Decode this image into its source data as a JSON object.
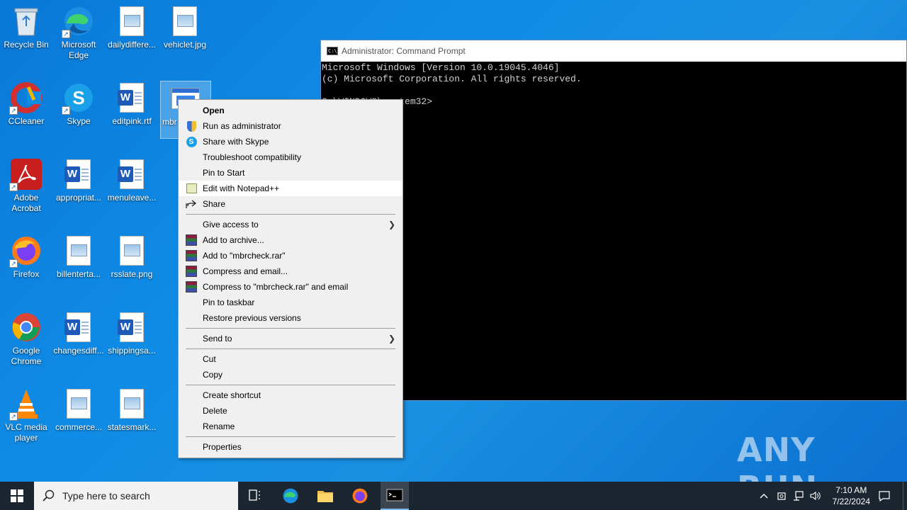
{
  "desktop": {
    "icons": [
      {
        "label": "Recycle Bin",
        "icon": "recycle-bin-icon"
      },
      {
        "label": "Microsoft Edge",
        "icon": "edge-icon"
      },
      {
        "label": "dailydiffere...",
        "icon": "image-file-icon"
      },
      {
        "label": "vehiclet.jpg",
        "icon": "image-file-icon"
      },
      {
        "label": "CCleaner",
        "icon": "ccleaner-icon"
      },
      {
        "label": "Skype",
        "icon": "skype-icon"
      },
      {
        "label": "editpink.rtf",
        "icon": "word-doc-icon"
      },
      {
        "label": "mbr",
        "icon": "exe-file-icon"
      },
      {
        "label": "Adobe Acrobat",
        "icon": "acrobat-icon"
      },
      {
        "label": "appropriat...",
        "icon": "word-doc-icon"
      },
      {
        "label": "menuleave...",
        "icon": "word-doc-icon"
      },
      {
        "label": "Firefox",
        "icon": "firefox-icon"
      },
      {
        "label": "billenterta...",
        "icon": "image-file-icon"
      },
      {
        "label": "rsslate.png",
        "icon": "image-file-icon"
      },
      {
        "label": "Google Chrome",
        "icon": "chrome-icon"
      },
      {
        "label": "changesdiff...",
        "icon": "word-doc-icon"
      },
      {
        "label": "shippingsa...",
        "icon": "word-doc-icon"
      },
      {
        "label": "VLC media player",
        "icon": "vlc-icon"
      },
      {
        "label": "commerce...",
        "icon": "image-file-icon"
      },
      {
        "label": "statesmark...",
        "icon": "image-file-icon"
      }
    ]
  },
  "cmd": {
    "title": "Administrator: Command Prompt",
    "icon_text": "C:\\_",
    "lines": [
      "Microsoft Windows [Version 10.0.19045.4046]",
      "(c) Microsoft Corporation. All rights reserved.",
      "",
      "C:\\WINDOWS\\system32>"
    ]
  },
  "context_menu": {
    "items": [
      {
        "label": "Open"
      },
      {
        "label": "Run as administrator"
      },
      {
        "label": "Share with Skype"
      },
      {
        "label": "Troubleshoot compatibility"
      },
      {
        "label": "Pin to Start"
      },
      {
        "label": "Edit with Notepad++"
      },
      {
        "label": "Share"
      },
      {
        "label": "Give access to"
      },
      {
        "label": "Add to archive..."
      },
      {
        "label": "Add to \"mbrcheck.rar\""
      },
      {
        "label": "Compress and email..."
      },
      {
        "label": "Compress to \"mbrcheck.rar\" and email"
      },
      {
        "label": "Pin to taskbar"
      },
      {
        "label": "Restore previous versions"
      },
      {
        "label": "Send to"
      },
      {
        "label": "Cut"
      },
      {
        "label": "Copy"
      },
      {
        "label": "Create shortcut"
      },
      {
        "label": "Delete"
      },
      {
        "label": "Rename"
      },
      {
        "label": "Properties"
      }
    ]
  },
  "taskbar": {
    "search_placeholder": "Type here to search",
    "time": "7:10 AM",
    "date": "7/22/2024"
  },
  "watermark": "ANY RUN",
  "colors": {
    "desktop": "#0f8ce6",
    "taskbar": "#1c2630",
    "menu_bg": "#f0f0f0",
    "menu_hover": "#ffffff"
  }
}
